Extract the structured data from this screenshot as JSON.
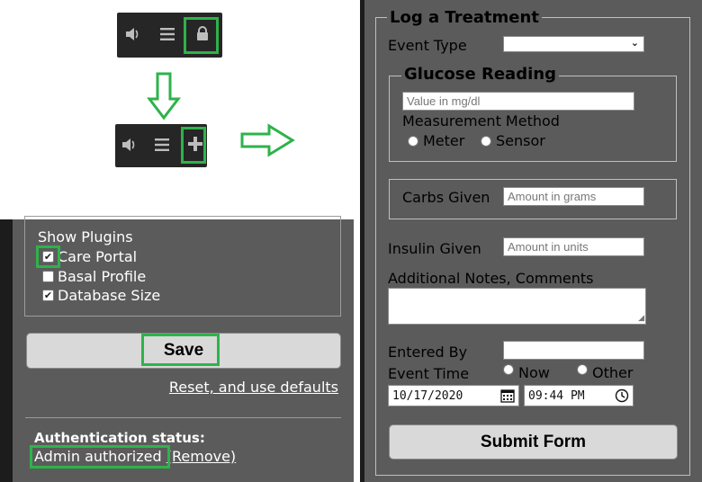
{
  "toolbar_icons": {
    "speaker": "speaker-icon",
    "menu": "hamburger-menu-icon",
    "lock": "lock-icon",
    "plus": "plus-icon"
  },
  "plugins": {
    "title": "Show Plugins",
    "items": [
      {
        "label": "Care Portal",
        "checked": true
      },
      {
        "label": "Basal Profile",
        "checked": false
      },
      {
        "label": "Database Size",
        "checked": true
      }
    ]
  },
  "settings": {
    "save_label": "Save",
    "reset_label": "Reset, and use defaults",
    "auth_title": "Authentication status:",
    "auth_value": "Admin authorized",
    "auth_remove": "(Remove)"
  },
  "form": {
    "title": "Log a Treatment",
    "event_type_label": "Event Type",
    "event_type_value": "",
    "glucose": {
      "title": "Glucose Reading",
      "placeholder": "Value in mg/dl",
      "method_label": "Measurement Method",
      "meter_label": "Meter",
      "sensor_label": "Sensor"
    },
    "carbs_label": "Carbs Given",
    "carbs_placeholder": "Amount in grams",
    "insulin_label": "Insulin Given",
    "insulin_placeholder": "Amount in units",
    "notes_label": "Additional Notes, Comments",
    "entered_by_label": "Entered By",
    "event_time_label": "Event Time",
    "now_label": "Now",
    "other_label": "Other",
    "date_value": "10/17/2020",
    "time_value": "09:44 PM",
    "submit_label": "Submit Form"
  },
  "colors": {
    "highlight": "#2eb34a",
    "panel": "#5b5b5b",
    "button": "#d9d9d9"
  }
}
